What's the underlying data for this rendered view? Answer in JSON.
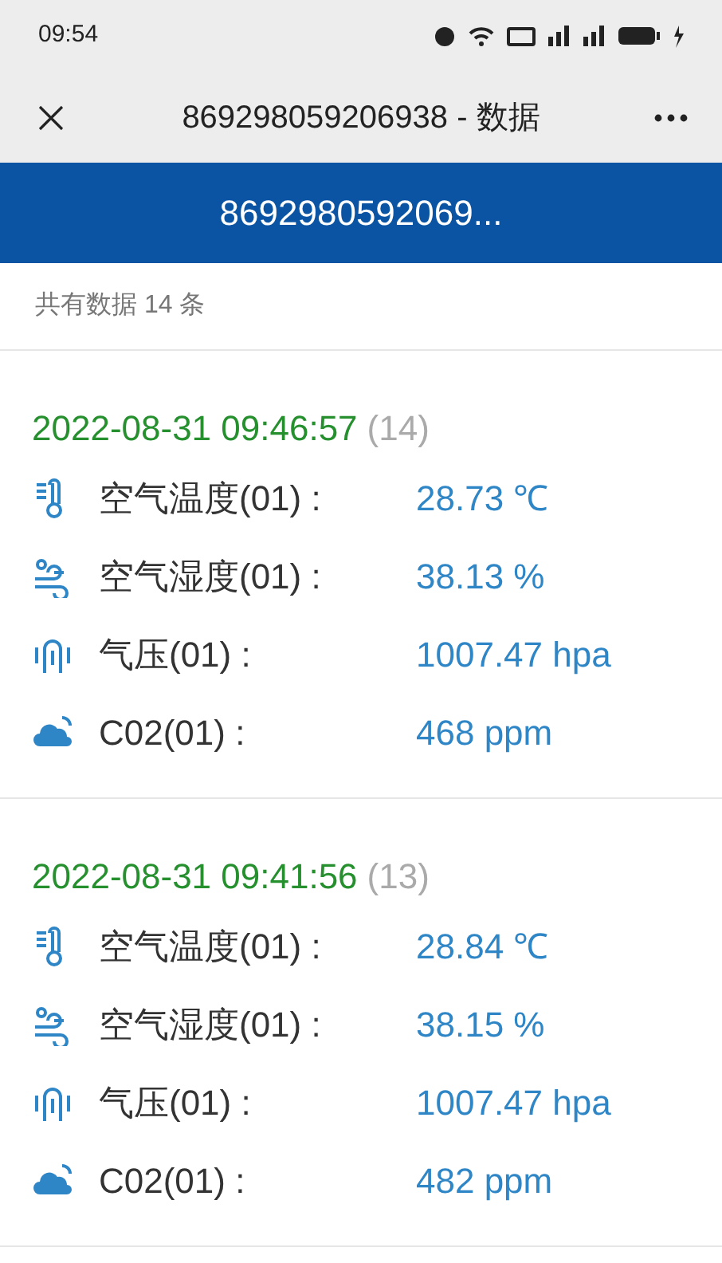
{
  "status_bar": {
    "time": "09:54"
  },
  "title_bar": {
    "title": "869298059206938 - 数据"
  },
  "header": {
    "title": "8692980592069..."
  },
  "summary": "共有数据 14 条",
  "records": [
    {
      "time": "2022-08-31 09:46:57",
      "index": "(14)",
      "readings": [
        {
          "kind": "temperature",
          "label": "空气温度(01) :",
          "value": "28.73 ℃"
        },
        {
          "kind": "humidity",
          "label": "空气湿度(01) :",
          "value": "38.13 %"
        },
        {
          "kind": "pressure",
          "label": "气压(01) :",
          "value": "1007.47 hpa"
        },
        {
          "kind": "co2",
          "label": "C02(01) :",
          "value": "468 ppm"
        }
      ]
    },
    {
      "time": "2022-08-31 09:41:56",
      "index": "(13)",
      "readings": [
        {
          "kind": "temperature",
          "label": "空气温度(01) :",
          "value": "28.84 ℃"
        },
        {
          "kind": "humidity",
          "label": "空气湿度(01) :",
          "value": "38.15 %"
        },
        {
          "kind": "pressure",
          "label": "气压(01) :",
          "value": "1007.47 hpa"
        },
        {
          "kind": "co2",
          "label": "C02(01) :",
          "value": "482 ppm"
        }
      ]
    }
  ]
}
